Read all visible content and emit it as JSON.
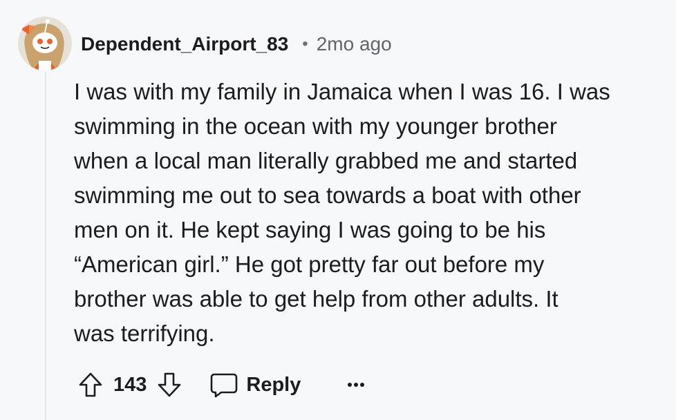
{
  "comment": {
    "author": "Dependent_Airport_83",
    "separator": "•",
    "time": "2mo ago",
    "body_lines": [
      "I was with my family in Jamaica when I was 16. I was",
      "swimming in the ocean with my younger brother",
      "when a local man literally grabbed me and started",
      "swimming me out to sea towards a boat with other",
      "men on it. He kept saying I was going to be his",
      "“American girl.” He got pretty far out before my",
      "brother was able to get help from other adults. It",
      "was terrifying."
    ]
  },
  "actions": {
    "upvote_icon": "arrow-up-outline-icon",
    "score": "143",
    "downvote_icon": "arrow-down-outline-icon",
    "reply_icon": "speech-bubble-icon",
    "reply_label": "Reply",
    "more_icon": "ellipsis-icon"
  },
  "colors": {
    "background": "#f7f8f9",
    "text": "#1c1c1c",
    "muted": "#5f6468",
    "thread_line": "#e3e6e8",
    "avatar_bg": "#e5e0d8",
    "avatar_hair": "#c9a36b",
    "avatar_bow": "#e8622c"
  }
}
